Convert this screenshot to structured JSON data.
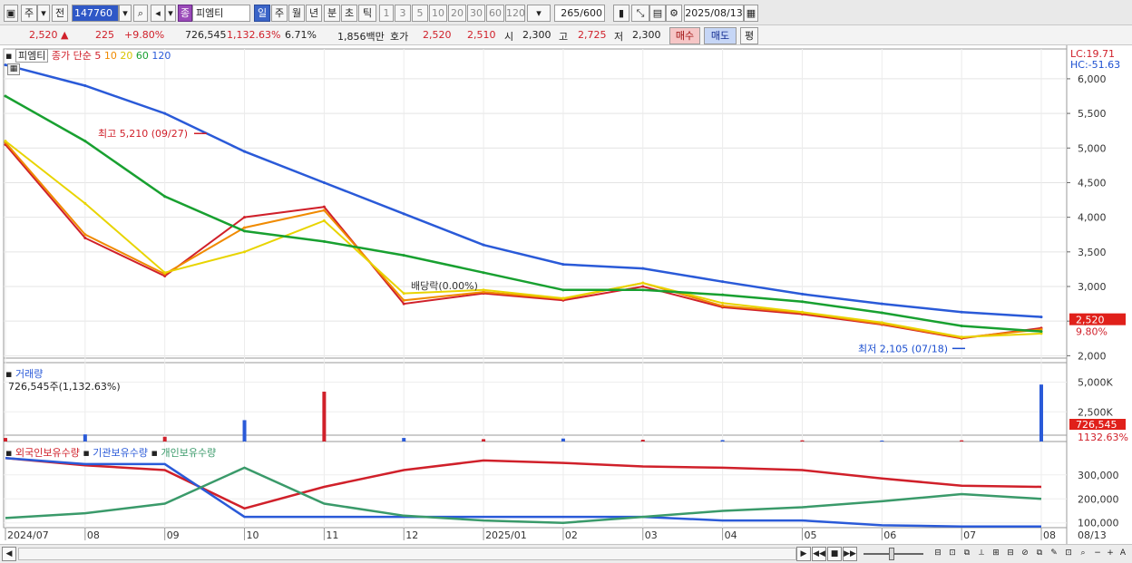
{
  "toolbar": {
    "period_main": "주",
    "prev_label": "전",
    "stock_code": "147760",
    "stock_type_badge": "종",
    "stock_name": "피엠티",
    "periods": [
      "일",
      "주",
      "월",
      "년",
      "분",
      "초",
      "틱"
    ],
    "active_period": "일",
    "intervals": [
      "1",
      "3",
      "5",
      "10",
      "20",
      "30",
      "60",
      "120"
    ],
    "count_value": "265",
    "count_total": "/600",
    "date": "2025/08/13"
  },
  "info": {
    "price": "2,520",
    "change_arrow": "▲",
    "change": "225",
    "change_pct": "+9.80%",
    "volume": "726,545",
    "volume_pct": "1,132.63%",
    "turnover": "6.71%",
    "amount": "1,856백만",
    "quote_label": "호가",
    "ask": "2,520",
    "bid": "2,510",
    "open_label": "시",
    "open": "2,300",
    "high_label": "고",
    "high": "2,725",
    "low_label": "저",
    "low": "2,300",
    "buy_btn": "매수",
    "sell_btn": "매도",
    "eval_btn": "평"
  },
  "price_panel": {
    "stock_label": "피엠티",
    "legend": [
      {
        "label": "종가 단순",
        "color": "#d0202a"
      },
      {
        "label": "5",
        "color": "#d0202a"
      },
      {
        "label": "10",
        "color": "#f08a00"
      },
      {
        "label": "20",
        "color": "#e8d400"
      },
      {
        "label": "60",
        "color": "#18a030"
      },
      {
        "label": "120",
        "color": "#2a5ad8"
      }
    ],
    "lc": "LC:19.71",
    "hc": "HC:-51.63",
    "y_ticks": [
      "6,000",
      "5,500",
      "5,000",
      "4,500",
      "4,000",
      "3,500",
      "3,000",
      "2,500",
      "2,000"
    ],
    "current_price_tag": "2,520",
    "current_pct_tag": "9.80%",
    "high_note": "최고 5,210 (09/27)",
    "low_note": "최저 2,105 (07/18)",
    "dividend_note": "배당락(0.00%)"
  },
  "volume_panel": {
    "title": "거래량",
    "subtitle": "726,545주(1,132.63%)",
    "y_ticks": [
      "5,000K",
      "2,500K"
    ],
    "tag_value": "726,545",
    "tag_pct": "1132.63%"
  },
  "holding_panel": {
    "legend": [
      {
        "label": "외국인보유수량",
        "color": "#d0202a"
      },
      {
        "label": "기관보유수량",
        "color": "#2a5ad8"
      },
      {
        "label": "개인보유수량",
        "color": "#3a9a6a"
      }
    ],
    "y_ticks": [
      "300,000",
      "200,000",
      "100,000"
    ]
  },
  "x_axis": {
    "labels": [
      "2024/07",
      "08",
      "09",
      "10",
      "11",
      "12",
      "2025/01",
      "02",
      "03",
      "04",
      "05",
      "06",
      "07",
      "08"
    ],
    "end_label": "08/13"
  },
  "chart_data": {
    "type": "line",
    "title": "",
    "xlabel": "",
    "ylabel": "",
    "x": [
      "2024/07",
      "08",
      "09",
      "10",
      "11",
      "12",
      "2025/01",
      "02",
      "03",
      "04",
      "05",
      "06",
      "07",
      "08"
    ],
    "ylim": [
      1900,
      6300
    ],
    "series": [
      {
        "name": "5",
        "color": "#d0202a",
        "values": [
          5050,
          3700,
          3150,
          4000,
          4150,
          2750,
          2900,
          2800,
          3000,
          2700,
          2600,
          2450,
          2250,
          2400
        ]
      },
      {
        "name": "10",
        "color": "#f08a00",
        "values": [
          5080,
          3750,
          3180,
          3850,
          4100,
          2800,
          2920,
          2820,
          3050,
          2720,
          2620,
          2460,
          2260,
          2380
        ]
      },
      {
        "name": "20",
        "color": "#e8d400",
        "values": [
          5100,
          4200,
          3200,
          3500,
          3950,
          2900,
          2950,
          2830,
          3050,
          2760,
          2630,
          2480,
          2270,
          2320
        ]
      },
      {
        "name": "60",
        "color": "#18a030",
        "values": [
          5750,
          5100,
          4300,
          3800,
          3650,
          3450,
          3200,
          2950,
          2950,
          2880,
          2780,
          2620,
          2430,
          2350
        ]
      },
      {
        "name": "120",
        "color": "#2a5ad8",
        "values": [
          6200,
          5900,
          5500,
          4950,
          4500,
          4050,
          3600,
          3320,
          3260,
          3070,
          2890,
          2750,
          2630,
          2560
        ]
      }
    ],
    "volume_K": [
      30,
      60,
      40,
      180,
      420,
      30,
      20,
      25,
      15,
      12,
      10,
      8,
      10,
      480
    ],
    "holdings": {
      "외국인보유수량": [
        370000,
        340000,
        320000,
        160000,
        250000,
        320000,
        360000,
        350000,
        335000,
        330000,
        320000,
        285000,
        255000,
        250000
      ],
      "기관보유수량": [
        370000,
        345000,
        345000,
        125000,
        125000,
        125000,
        125000,
        125000,
        125000,
        110000,
        110000,
        90000,
        85000,
        85000
      ],
      "개인보유수량": [
        120000,
        140000,
        180000,
        330000,
        180000,
        130000,
        110000,
        100000,
        125000,
        150000,
        165000,
        190000,
        220000,
        200000
      ]
    }
  }
}
